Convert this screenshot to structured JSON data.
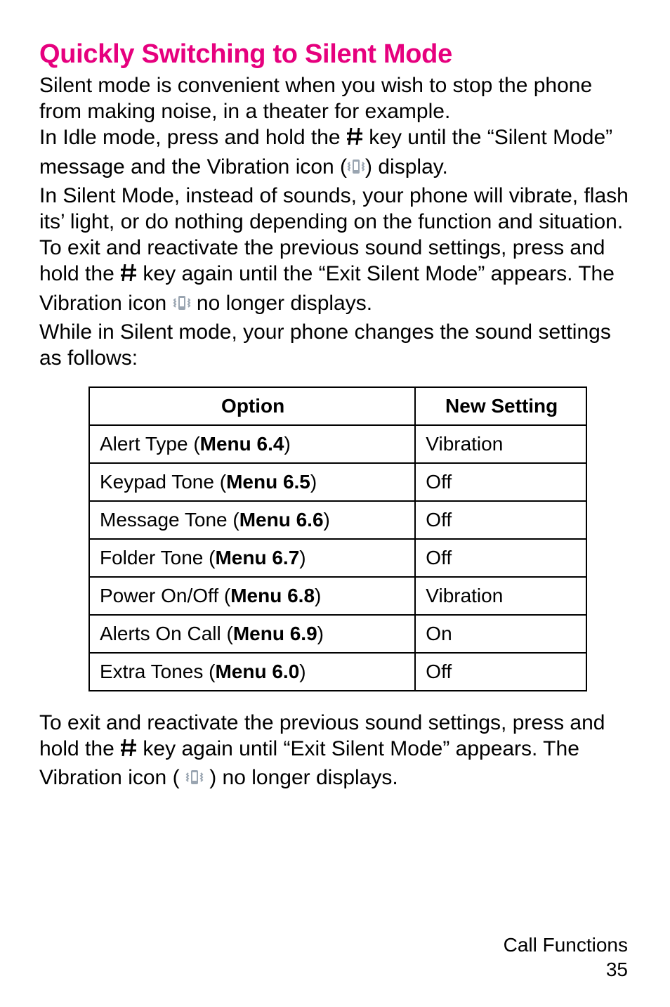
{
  "heading": "Quickly Switching to Silent Mode",
  "intro_p1": "Silent mode is convenient when you wish to stop the phone from making noise, in a theater for example.",
  "intro_p2a": "In Idle mode, press and hold the ",
  "intro_p2b": " key until the “Silent Mode” message and the Vibration icon (",
  "intro_p2c": ") display.",
  "intro_p3": "In Silent Mode, instead of sounds, your phone will vibrate, flash its’ light, or do nothing depending on the function and situation.",
  "intro_p4a": "To exit and reactivate the previous sound settings, press and hold the ",
  "intro_p4b": " key again until the “Exit Silent Mode” appears.  The Vibration icon ",
  "intro_p4c": " no longer displays.",
  "intro_p5": "While in Silent mode, your phone changes the sound settings as follows:",
  "table": {
    "col1": "Option",
    "col2": "New Setting",
    "rows": [
      {
        "option_prefix": "Alert Type (",
        "menu": "Menu 6.4",
        "option_suffix": ")",
        "setting": "Vibration"
      },
      {
        "option_prefix": "Keypad Tone (",
        "menu": "Menu 6.5",
        "option_suffix": ")",
        "setting": "Off"
      },
      {
        "option_prefix": "Message Tone (",
        "menu": "Menu 6.6",
        "option_suffix": ")",
        "setting": "Off"
      },
      {
        "option_prefix": "Folder Tone (",
        "menu": "Menu 6.7",
        "option_suffix": ")",
        "setting": "Off"
      },
      {
        "option_prefix": "Power On/Off (",
        "menu": "Menu 6.8",
        "option_suffix": ")",
        "setting": "Vibration"
      },
      {
        "option_prefix": "Alerts On Call (",
        "menu": "Menu 6.9",
        "option_suffix": ")",
        "setting": "On"
      },
      {
        "option_prefix": "Extra Tones (",
        "menu": "Menu 6.0",
        "option_suffix": ")",
        "setting": "Off"
      }
    ]
  },
  "outro_a": "To exit and reactivate the previous sound settings, press and hold the ",
  "outro_b": " key again until “Exit Silent Mode” appears. The Vibration icon ( ",
  "outro_c": " ) no longer displays.",
  "footer_label": "Call Functions",
  "footer_page": "35"
}
